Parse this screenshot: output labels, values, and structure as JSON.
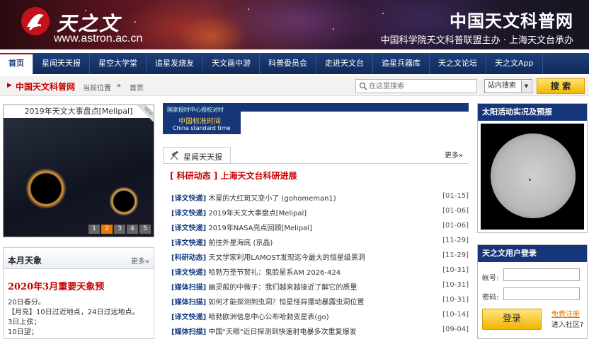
{
  "banner": {
    "logo_text": "天之文",
    "logo_url": "www.astron.ac.cn",
    "site_title": "中国天文科普网",
    "site_subtitle": "中国科学院天文科普联盟主办 · 上海天文台承办"
  },
  "nav": {
    "items": [
      {
        "label": "首页"
      },
      {
        "label": "星闻天天报"
      },
      {
        "label": "星空大学堂"
      },
      {
        "label": "追星发烧友"
      },
      {
        "label": "天文画中游"
      },
      {
        "label": "科普委员会"
      },
      {
        "label": "走进天文台"
      },
      {
        "label": "追星兵器库"
      },
      {
        "label": "天之文论坛"
      },
      {
        "label": "天之文App"
      }
    ]
  },
  "crumbbar": {
    "home": "中国天文科普网",
    "current_label": "当前位置",
    "sep": "»",
    "current": "首页",
    "search_placeholder": "在这里搜索",
    "scope": "站内搜索",
    "search_button": "搜 索"
  },
  "slider": {
    "caption": "2019年天文大事盘点[Melipal]",
    "pages": [
      "1",
      "2",
      "3",
      "4",
      "5"
    ],
    "active_page": 2
  },
  "month": {
    "title": "本月天象",
    "more": "更多»",
    "headline": "2020年3月重要天象预",
    "lines": [
      "20日春分。",
      "【月亮】10日过近地点，24日过远地点。",
      "3日上弦；",
      "10日望；"
    ]
  },
  "timebox": {
    "line1": "国家授时中心授权对时",
    "line2": "中国标准时间",
    "line3": "China standard time"
  },
  "news": {
    "tab_label": "星闻天天报",
    "more": "更多»",
    "feature": "[ 科研动态 ] 上海天文台科研进展",
    "items": [
      {
        "cat": "[译文快递]",
        "title": "木星的大红斑又变小了 (gohomeman1)",
        "date": "[01-15]"
      },
      {
        "cat": "[译文快递]",
        "title": "2019年天文大事盘点[Melipal]",
        "date": "[01-06]"
      },
      {
        "cat": "[译文快递]",
        "title": "2019年NASA亮点回顾[Melipal]",
        "date": "[01-06]"
      },
      {
        "cat": "[译文快递]",
        "title": "前往外星海底 (京晶)",
        "date": "[11-29]"
      },
      {
        "cat": "[科研动态]",
        "title": "天文学家利用LAMOST发现迄今最大的恒星级黑洞",
        "date": "[11-29]"
      },
      {
        "cat": "[译文快递]",
        "title": "哈勃万圣节贺礼：鬼脸星系AM 2026-424",
        "date": "[10-31]"
      },
      {
        "cat": "[媒体扫描]",
        "title": "幽灵般的中微子：我们越来越接近了解它的质量",
        "date": "[10-31]"
      },
      {
        "cat": "[媒体扫描]",
        "title": "如何才能探测到虫洞？恒星怪异摆动暴露虫洞位置",
        "date": "[10-31]"
      },
      {
        "cat": "[译文快递]",
        "title": "哈勃欧洲信息中心公布哈勃变星表(go)",
        "date": "[10-14]"
      },
      {
        "cat": "[媒体扫描]",
        "title": "中国\"天眼\"近日探测到快速射电暴多次重复爆发",
        "date": "[09-04]"
      }
    ]
  },
  "sun": {
    "title": "太阳活动实况及预报"
  },
  "login": {
    "title": "天之文用户登录",
    "account_label": "帐号:",
    "password_label": "密码:",
    "login_button": "登录",
    "register": "免费注册",
    "enter": "进入社区?"
  },
  "colors": {
    "nav_blue": "#17367a",
    "accent_red": "#c90000",
    "button_gold": "#f3b800"
  }
}
